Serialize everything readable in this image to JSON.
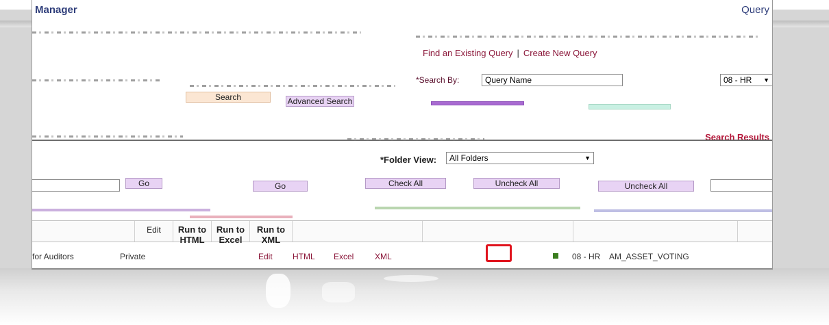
{
  "app": {
    "title": "Manager",
    "page_title": "Query"
  },
  "nav_links": {
    "find": "Find an Existing Query",
    "separator": "|",
    "create": "Create New Query"
  },
  "search": {
    "label": "*Search By:",
    "by_value": "Query Name",
    "source_value": "08 - HR"
  },
  "buttons": {
    "search": "Search",
    "advanced_search": "Advanced Search",
    "go_left": "Go",
    "go_right": "Go",
    "check_all": "Check All",
    "uncheck_all": "Uncheck All",
    "uncheck_all_right": "Uncheck All"
  },
  "results": {
    "label": "Search Results",
    "folder_view_label": "*Folder View:",
    "folder_view_value": "All Folders"
  },
  "grid": {
    "headers": [
      "Edit",
      "Run to HTML",
      "Run to Excel",
      "Run to XML"
    ],
    "row": {
      "owner": "Private",
      "edit": "Edit",
      "html": "HTML",
      "excel": "Excel",
      "xml": "XML",
      "source": "08 - HR",
      "description": "AM_ASSET_VOTING"
    },
    "row_prefix": "for Auditors"
  },
  "colors": {
    "highlight": "#e0141e",
    "link": "#8a1538",
    "button": "#e8d3f4"
  }
}
